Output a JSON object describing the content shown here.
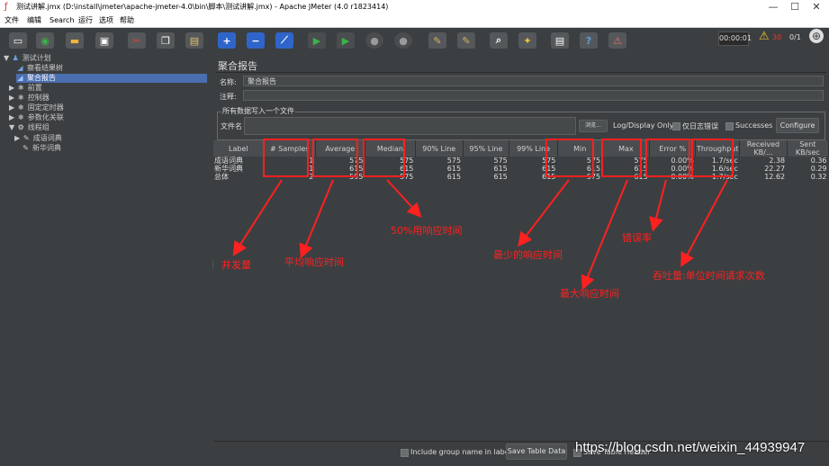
{
  "window": {
    "title": "测试讲解.jmx (D:\\install\\jmeter\\apache-jmeter-4.0\\bin\\脚本\\测试讲解.jmx) - Apache JMeter (4.0 r1823414)",
    "minimize": "—",
    "maximize": "☐",
    "close": "✕"
  },
  "menu": [
    "文件",
    "编辑",
    "Search",
    "运行",
    "选项",
    "帮助"
  ],
  "toolbar": {
    "timer": "00:00:01",
    "warning_count": "30",
    "thread_ratio": "0/1",
    "icons": [
      "new-icon",
      "templates-icon",
      "open-icon",
      "save-icon",
      "cut-icon",
      "copy-icon",
      "paste-icon",
      "expand-icon",
      "collapse-icon",
      "toggle-icon",
      "start-icon",
      "start-no-pause-icon",
      "stop-icon",
      "shutdown-icon",
      "clear-icon",
      "clear-all-icon",
      "search-icon",
      "reset-search-icon",
      "function-helper-icon",
      "help-icon",
      "log-viewer-icon"
    ]
  },
  "tree": [
    {
      "label": "测试计划",
      "icon": "test-plan-icon",
      "indent": 0,
      "expand": "▼"
    },
    {
      "label": "察看结果树",
      "icon": "listener-icon",
      "indent": 1,
      "expand": ""
    },
    {
      "label": "聚合报告",
      "icon": "listener-icon",
      "indent": 1,
      "expand": "",
      "selected": true
    },
    {
      "label": "前置",
      "icon": "gear-icon",
      "indent": 1,
      "expand": "▶"
    },
    {
      "label": "控制器",
      "icon": "gear-icon",
      "indent": 1,
      "expand": "▶"
    },
    {
      "label": "固定定时器",
      "icon": "gear-icon",
      "indent": 1,
      "expand": "▶"
    },
    {
      "label": "参数化关联",
      "icon": "gear-icon",
      "indent": 1,
      "expand": "▶"
    },
    {
      "label": "线程组",
      "icon": "thread-group-icon",
      "indent": 1,
      "expand": "▼"
    },
    {
      "label": "成语词典",
      "icon": "pencil-icon",
      "indent": 2,
      "expand": "▶"
    },
    {
      "label": "新华词典",
      "icon": "pencil-icon",
      "indent": 2,
      "expand": ""
    }
  ],
  "panel": {
    "title": "聚合报告",
    "name_label": "名称:",
    "name_value": "聚合报告",
    "comment_label": "注释:",
    "comment_value": "",
    "file_group_legend": "所有数据写入一个文件",
    "filename_label": "文件名",
    "browse_label": "浏览...",
    "log_display_label": "Log/Display Only:",
    "errors_only_label": "仅日志错误",
    "successes_label": "Successes",
    "configure_label": "Configure"
  },
  "table": {
    "headers": [
      "Label",
      "# Samples",
      "Average",
      "Median",
      "90% Line",
      "95% Line",
      "99% Line",
      "Min",
      "Max",
      "Error %",
      "Throughput",
      "Received KB/...",
      "Sent KB/sec"
    ],
    "rows": [
      [
        "成语词典",
        "1",
        "575",
        "575",
        "575",
        "575",
        "575",
        "575",
        "575",
        "0.00%",
        "1.7/sec",
        "2.38",
        "0.36"
      ],
      [
        "新华词典",
        "1",
        "615",
        "615",
        "615",
        "615",
        "615",
        "615",
        "615",
        "0.00%",
        "1.6/sec",
        "22.27",
        "0.29"
      ],
      [
        "总体",
        "2",
        "595",
        "575",
        "615",
        "615",
        "615",
        "575",
        "615",
        "0.00%",
        "1.7/sec",
        "12.62",
        "0.32"
      ]
    ]
  },
  "bottom": {
    "include_group_label": "Include group name in label?",
    "save_table_label": "Save Table Data",
    "save_header_label": "Save Table Header"
  },
  "annotations": {
    "samples": "并发量",
    "average": "平均响应时间",
    "median": "50%用响应时间",
    "min": "最少的响应时间",
    "error": "错误率",
    "max": "最大响应时间",
    "throughput": "吞吐量:单位时间请求次数"
  },
  "watermark": "https://blog.csdn.net/weixin_44939947",
  "colors": {
    "annotation_red": "#ff2020",
    "selection_blue": "#4b6eaf",
    "background": "#3c3f41"
  }
}
